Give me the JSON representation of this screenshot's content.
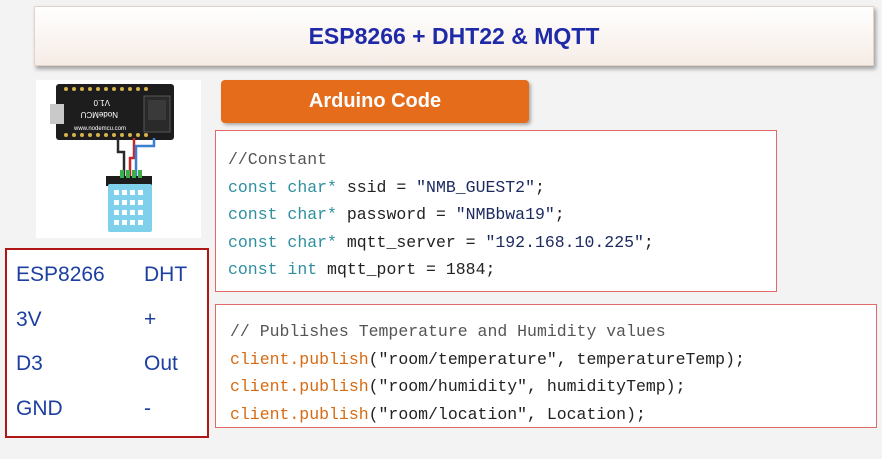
{
  "title": "ESP8266 + DHT22 & MQTT",
  "diagram": {
    "board_text_1": "V1.0",
    "board_text_2": "NodeMCU",
    "board_text_3": "www.nodemcu.com",
    "board_color": "#1d1d1d",
    "sensor_color": "#7fd0ea"
  },
  "code_tab_label": "Arduino Code",
  "constants_block": {
    "comment": "//Constant",
    "lines": [
      {
        "kw": "const",
        "type": "char*",
        "rest": " ssid = ",
        "str": "\"NMB_GUEST2\"",
        "end": ";"
      },
      {
        "kw": "const",
        "type": "char*",
        "rest": " password = ",
        "str": "\"NMBbwa19\"",
        "end": ";"
      },
      {
        "kw": "const",
        "type": "char*",
        "rest": " mqtt_server = ",
        "str": "\"192.168.10.225\"",
        "end": ";"
      },
      {
        "kw": "const",
        "type": "int",
        "rest": " mqtt_port = 1884;",
        "str": "",
        "end": ""
      }
    ]
  },
  "publish_block": {
    "comment": "// Publishes Temperature and Humidity values",
    "lines": [
      {
        "fn": "client.publish",
        "args": "(\"room/temperature\", temperatureTemp);"
      },
      {
        "fn": "client.publish",
        "args": "(\"room/humidity\", humidityTemp);"
      },
      {
        "fn": "client.publish",
        "args": "(\"room/location\", Location);"
      }
    ]
  },
  "pin_table": {
    "rows": [
      {
        "a": "ESP8266",
        "b": "DHT"
      },
      {
        "a": "3V",
        "b": "+"
      },
      {
        "a": "D3",
        "b": "Out"
      },
      {
        "a": "GND",
        "b": "-"
      }
    ]
  }
}
